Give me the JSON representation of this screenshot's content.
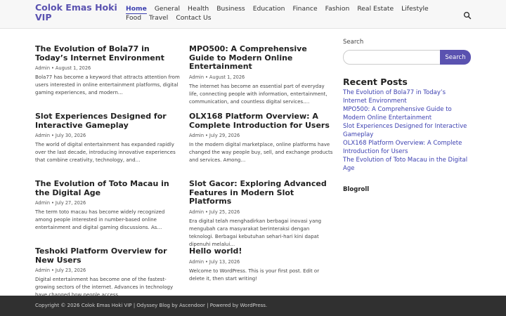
{
  "site": {
    "title": "Colok Emas Hoki VIP"
  },
  "nav": {
    "items": [
      {
        "label": "Home"
      },
      {
        "label": "General"
      },
      {
        "label": "Health"
      },
      {
        "label": "Business"
      },
      {
        "label": "Education"
      },
      {
        "label": "Finance"
      },
      {
        "label": "Fashion"
      },
      {
        "label": "Real Estate"
      },
      {
        "label": "Lifestyle"
      },
      {
        "label": "Food"
      },
      {
        "label": "Travel"
      },
      {
        "label": "Contact Us"
      }
    ],
    "search_icon": "search-icon"
  },
  "posts": [
    {
      "title": "The Evolution of Bola77 in Today’s Internet Environment",
      "author": "Admin",
      "date": "August 1, 2026",
      "excerpt": "Bola77 has become a keyword that attracts attention from users interested in online entertainment platforms, digital gaming experiences, and modern…"
    },
    {
      "title": "MPO500: A Comprehensive Guide to Modern Online Entertainment",
      "author": "Admin",
      "date": "August 1, 2026",
      "excerpt": "The internet has become an essential part of everyday life, connecting people with information, entertainment, communication, and countless digital services.…"
    },
    {
      "title": "Slot Experiences Designed for Interactive Gameplay",
      "author": "Admin",
      "date": "July 30, 2026",
      "excerpt": "The world of digital entertainment has expanded rapidly over the last decade, introducing innovative experiences that combine creativity, technology, and…"
    },
    {
      "title": "OLX168 Platform Overview: A Complete Introduction for Users",
      "author": "Admin",
      "date": "July 29, 2026",
      "excerpt": "In the modern digital marketplace, online platforms have changed the way people buy, sell, and exchange products and services. Among…"
    },
    {
      "title": "The Evolution of Toto Macau in the Digital Age",
      "author": "Admin",
      "date": "July 27, 2026",
      "excerpt": "The term toto macau has become widely recognized among people interested in number-based online entertainment and digital gaming discussions. As…"
    },
    {
      "title": "Slot Gacor: Exploring Advanced Features in Modern Slot Platforms",
      "author": "Admin",
      "date": "July 25, 2026",
      "excerpt": "Era digital telah menghadirkan berbagai inovasi yang mengubah cara masyarakat berinteraksi dengan teknologi. Berbagai kebutuhan sehari-hari kini dapat dipenuhi melalui…"
    },
    {
      "title": "Teshoki Platform Overview for New Users",
      "author": "Admin",
      "date": "July 23, 2026",
      "excerpt": "Digital entertainment has become one of the fastest-growing sectors of the internet. Advances in technology have changed how people access…"
    },
    {
      "title": "Hello world!",
      "author": "Admin",
      "date": "July 13, 2026",
      "excerpt": "Welcome to WordPress. This is your first post. Edit or delete it, then start writing!"
    }
  ],
  "sidebar": {
    "search_label": "Search",
    "search_placeholder": "",
    "search_button": "Search",
    "recent_heading": "Recent Posts",
    "recent_posts": [
      "The Evolution of Bola77 in Today’s Internet Environment",
      "MPO500: A Comprehensive Guide to Modern Online Entertainment",
      "Slot Experiences Designed for Interactive Gameplay",
      "OLX168 Platform Overview: A Complete Introduction for Users",
      "The Evolution of Toto Macau in the Digital Age"
    ],
    "blogroll_heading": "Blogroll"
  },
  "footer": {
    "text": "Copyright © 2026 Colok Emas Hoki VIP | Odyssey Blog by Ascendoor | Powered by WordPress."
  },
  "colors": {
    "accent": "#5a52b0",
    "link": "#3b3fb0",
    "footer_bg": "#303030",
    "header_bg": "#f7f7f7"
  }
}
